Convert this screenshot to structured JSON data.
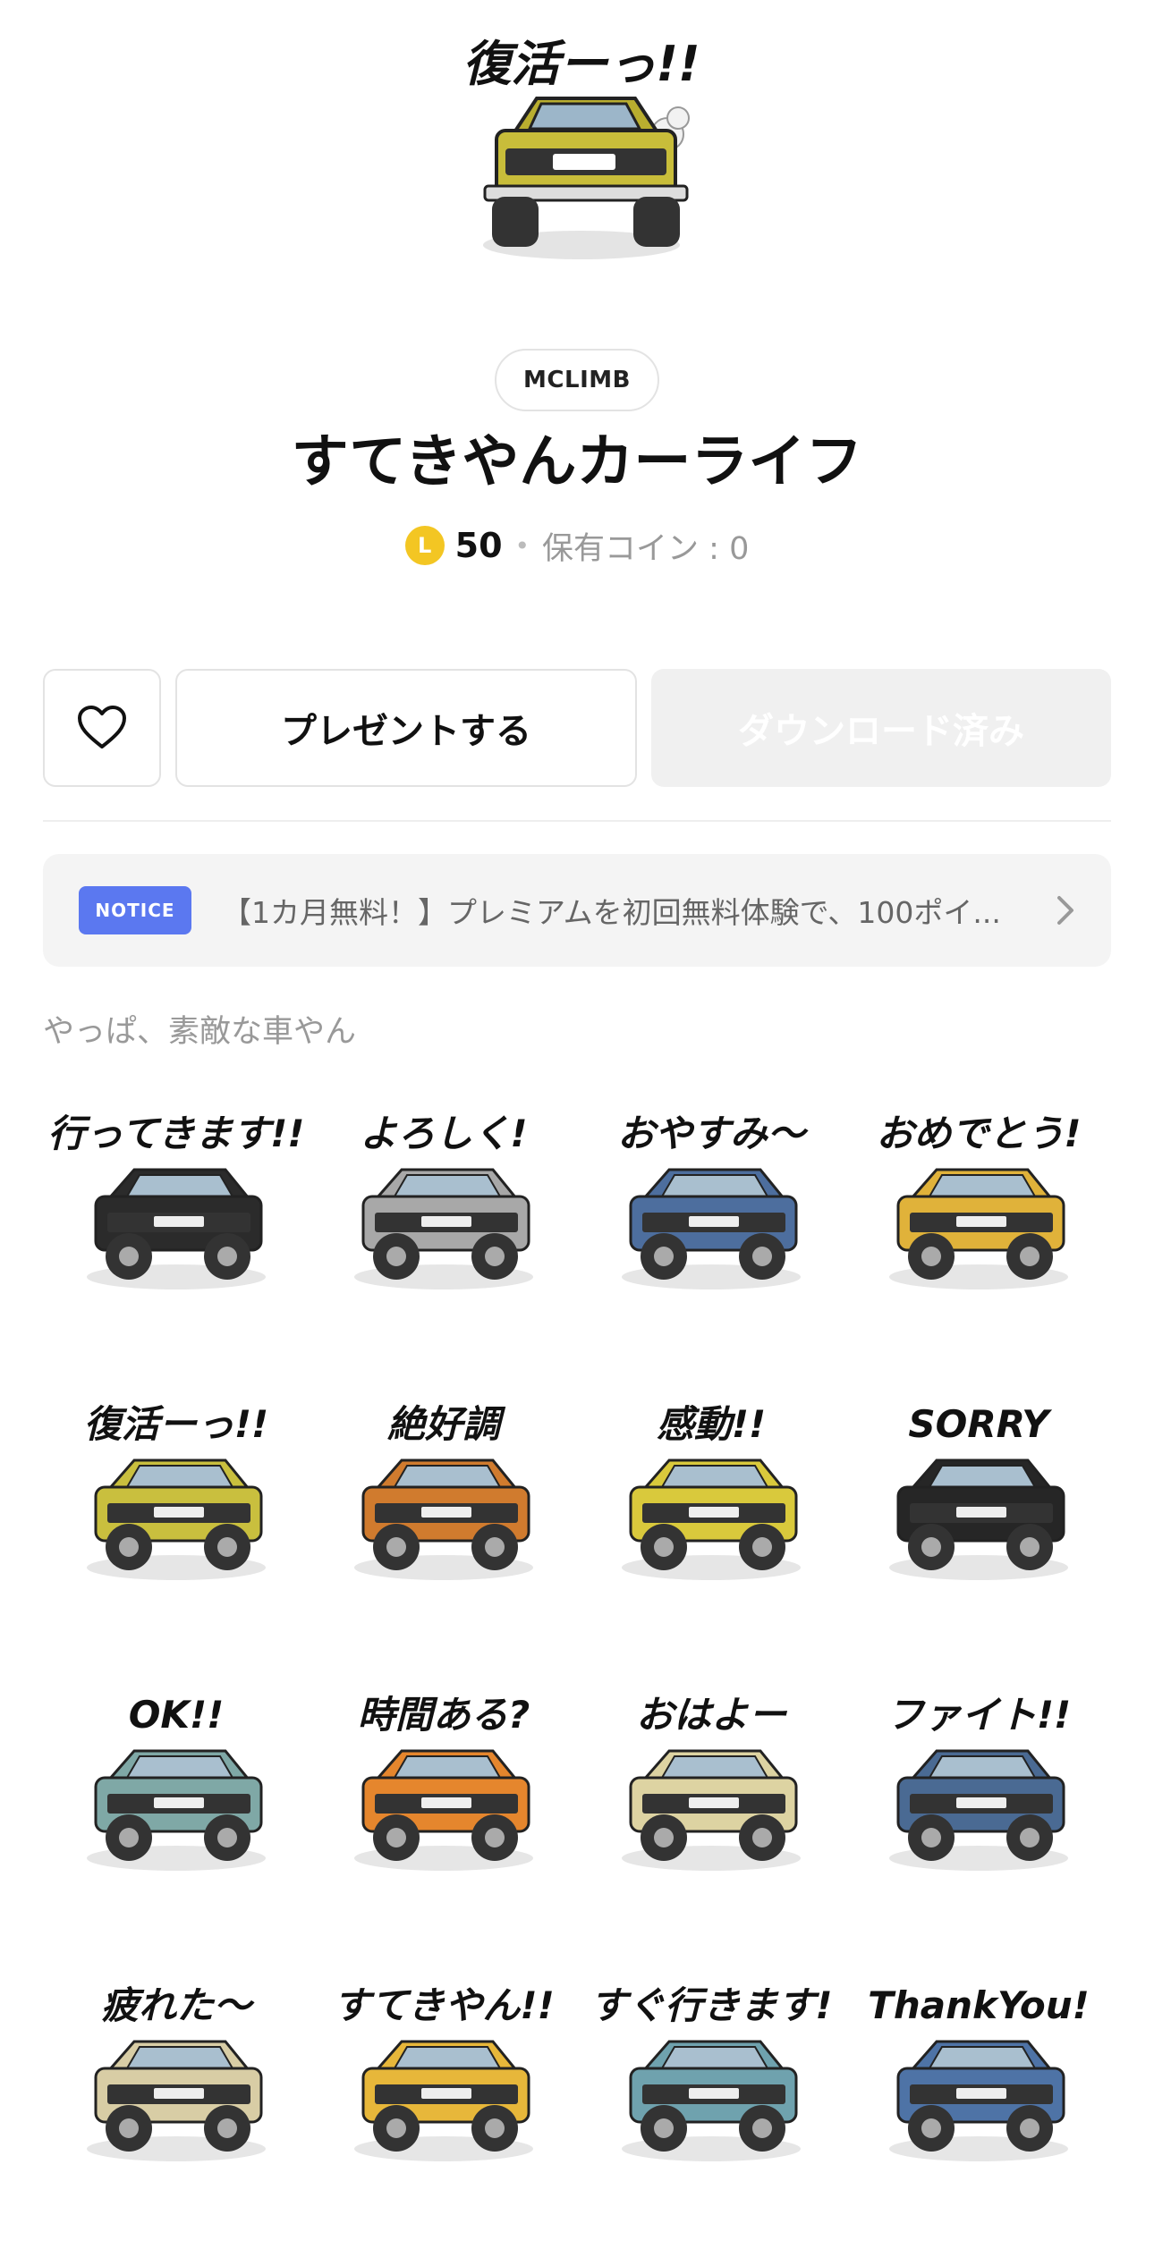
{
  "hero": {
    "label": "復活ーっ!!",
    "icon": "jeep-hero-sticker"
  },
  "author": "MCLIMB",
  "title": "すてきやんカーライフ",
  "price": {
    "coin_letter": "L",
    "amount": "50",
    "separator": "•",
    "owned": "保有コイン : 0"
  },
  "buttons": {
    "favorite_icon": "heart-outline-icon",
    "gift": "プレゼントする",
    "download": "ダウンロード済み"
  },
  "notice": {
    "badge": "NOTICE",
    "text": "【1カ月無料！】プレミアムを初回無料体験で、100ポイ...",
    "icon": "chevron-right-icon"
  },
  "subtitle": "やっぱ、素敵な車やん",
  "stickers": [
    {
      "label": "行ってきます!!",
      "color": "#2b2b2b"
    },
    {
      "label": "よろしく!",
      "color": "#a8a8a8"
    },
    {
      "label": "おやすみ～",
      "color": "#4d6e9e"
    },
    {
      "label": "おめでとう!",
      "color": "#e0b23a"
    },
    {
      "label": "復活ーっ!!",
      "color": "#c9bf3e"
    },
    {
      "label": "絶好調",
      "color": "#d07b2e"
    },
    {
      "label": "感動!!",
      "color": "#d9c93c"
    },
    {
      "label": "SORRY",
      "color": "#262626"
    },
    {
      "label": "OK!!",
      "color": "#7fa8a6"
    },
    {
      "label": "時間ある?",
      "color": "#e5862d"
    },
    {
      "label": "おはよー",
      "color": "#ddd3a2"
    },
    {
      "label": "ファイト!!",
      "color": "#4a6a93"
    },
    {
      "label": "疲れた～",
      "color": "#d8cda5"
    },
    {
      "label": "すてきやん!!",
      "color": "#e7b73a"
    },
    {
      "label": "すぐ行きます!",
      "color": "#6fa2ae"
    },
    {
      "label": "ThankYou!",
      "color": "#4e73a6"
    }
  ],
  "colors": {
    "coin": "#f3c623",
    "notice_badge": "#5b78f0"
  }
}
